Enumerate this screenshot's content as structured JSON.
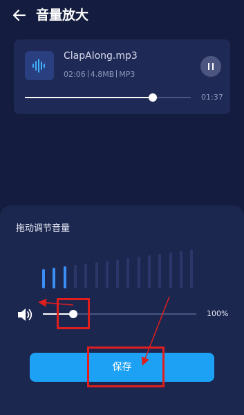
{
  "header": {
    "title": "音量放大",
    "back_icon": "arrow-left-icon"
  },
  "player": {
    "file_name": "ClapAlong.mp3",
    "duration": "02:06",
    "size": "4.8MB",
    "format": "MP3",
    "remaining_time": "01:37",
    "progress_percent": 77,
    "icon": "audio-waveform-icon",
    "pause_icon": "pause-icon"
  },
  "volume_panel": {
    "title": "拖动调节音量",
    "level_bars": {
      "total": 15,
      "active": 3
    },
    "volume_value": "100%",
    "slider_percent": 20,
    "speaker_icon": "speaker-icon"
  },
  "save_button": {
    "label": "保存"
  },
  "colors": {
    "background": "#141c3f",
    "card": "#1e2a55",
    "sheet": "#1c274f",
    "accent": "#1ca1f5",
    "active_bar": "#3a8ef5",
    "inactive_bar": "#2c3769",
    "annotation": "#e01e1e"
  }
}
